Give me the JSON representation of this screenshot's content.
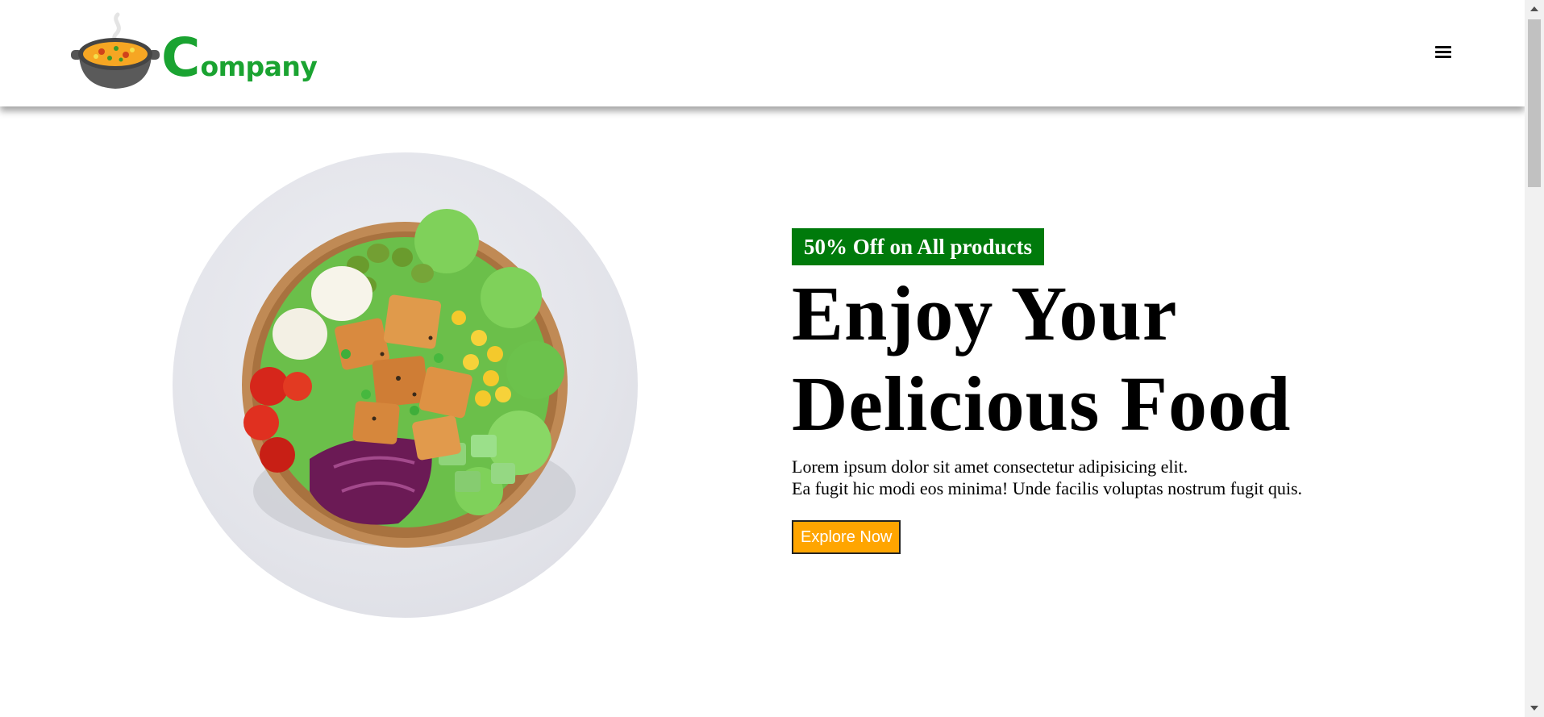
{
  "header": {
    "logo": {
      "pot_icon": "soup-pot-icon",
      "text_initial": "C",
      "text_rest": "ompany",
      "color": "#1aa331"
    },
    "menu_icon": "hamburger-menu-icon"
  },
  "hero": {
    "image": "salad-bowl-image",
    "badge": "50% Off on All products",
    "badge_color": "#007a0b",
    "title_line1": "Enjoy Your",
    "title_line2": "Delicious Food",
    "desc_line1": "Lorem ipsum dolor sit amet consectetur adipisicing elit.",
    "desc_line2": "Ea fugit hic modi eos minima! Unde facilis voluptas nostrum fugit quis.",
    "cta_label": "Explore Now",
    "cta_color": "#ffa500"
  }
}
